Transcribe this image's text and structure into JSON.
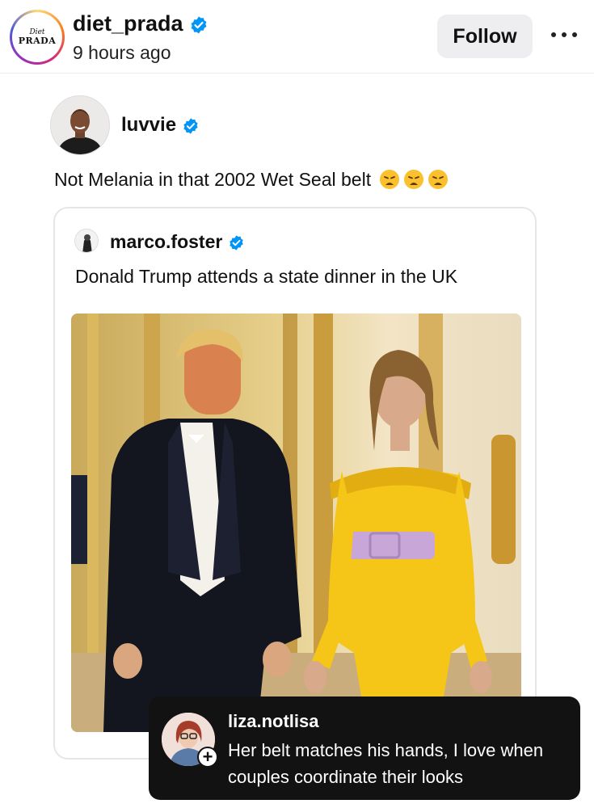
{
  "header": {
    "logo_line1": "Diet",
    "logo_line2": "PRADA",
    "account_name": "diet_prada",
    "time_ago": "9 hours ago",
    "follow_label": "Follow",
    "more_icon": "more-horizontal-icon"
  },
  "post": {
    "username": "luvvie",
    "text": "Not Melania in that 2002 Wet Seal belt",
    "emoji_count": 3
  },
  "quoted": {
    "username": "marco.foster",
    "text": "Donald Trump attends a state dinner in the UK"
  },
  "comment": {
    "username": "liza.notlisa",
    "text": "Her belt matches his hands, I love when couples coordinate their looks"
  },
  "colors": {
    "verified": "#0095f6",
    "dress": "#f5c518",
    "belt": "#c8a6d8",
    "comment_bg": "#121212"
  }
}
